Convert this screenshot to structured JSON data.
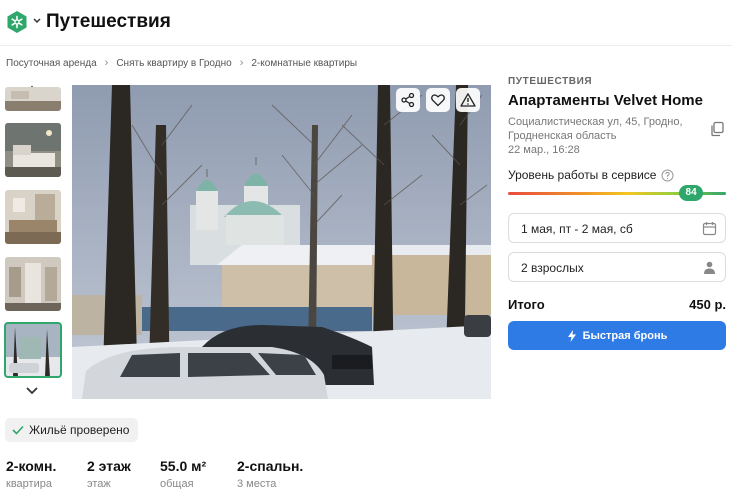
{
  "header": {
    "title": "Путешествия"
  },
  "breadcrumb": [
    "Посуточная аренда",
    "Снять квартиру в Гродно",
    "2-комнатные квартиры"
  ],
  "gallery": {
    "thumb_count": 5,
    "active_index": 4
  },
  "listing": {
    "section": "ПУТЕШЕСТВИЯ",
    "title": "Апартаменты Velvet Home",
    "address": "Социалистическая ул, 45, Гродно, Гродненская область",
    "posted": "22 мар., 16:28"
  },
  "service": {
    "label": "Уровень работы в сервисе",
    "score": "84",
    "score_value": 84,
    "score_max": 100
  },
  "booking": {
    "dates": "1 мая, пт - 2 мая, сб",
    "guests": "2 взрослых",
    "total_label": "Итого",
    "total_price": "450 р.",
    "button_label": "Быстрая бронь"
  },
  "verified": "Жильё проверено",
  "stats": [
    {
      "value": "2-комн.",
      "label": "квартира"
    },
    {
      "value": "2 этаж",
      "label": "этаж"
    },
    {
      "value": "55.0 м²",
      "label": "общая"
    },
    {
      "value": "2-спальн.",
      "label": "3 места"
    }
  ],
  "colors": {
    "brand": "#2fa66a",
    "accent": "#2f7be6"
  }
}
